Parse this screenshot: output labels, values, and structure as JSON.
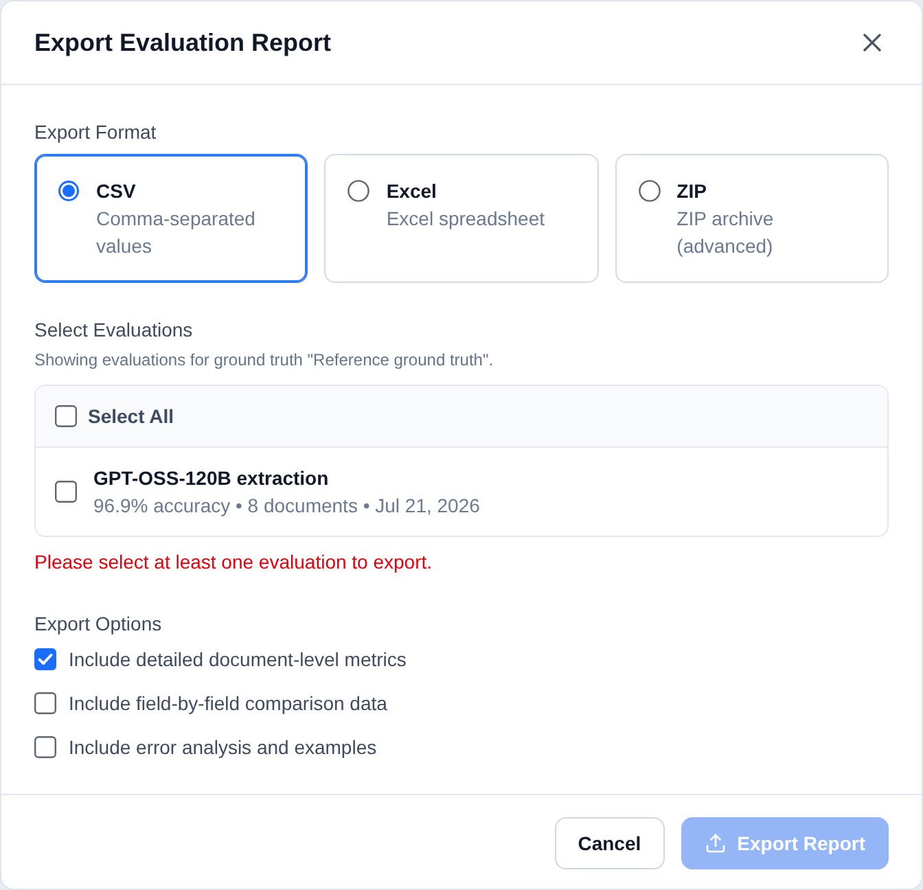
{
  "dialog": {
    "title": "Export Evaluation Report"
  },
  "export_format": {
    "label": "Export Format",
    "options": [
      {
        "name": "CSV",
        "description": "Comma-separated values",
        "selected": true
      },
      {
        "name": "Excel",
        "description": "Excel spreadsheet",
        "selected": false
      },
      {
        "name": "ZIP",
        "description": "ZIP archive (advanced)",
        "selected": false
      }
    ]
  },
  "select_evaluations": {
    "label": "Select Evaluations",
    "hint": "Showing evaluations for ground truth \"Reference ground truth\".",
    "select_all": {
      "label": "Select All",
      "checked": false
    },
    "evaluations": [
      {
        "name": "GPT-OSS-120B extraction",
        "details": "96.9% accuracy • 8 documents • Jul 21, 2026",
        "checked": false
      }
    ],
    "error": "Please select at least one evaluation to export."
  },
  "export_options": {
    "label": "Export Options",
    "options": [
      {
        "label": "Include detailed document-level metrics",
        "checked": true
      },
      {
        "label": "Include field-by-field comparison data",
        "checked": false
      },
      {
        "label": "Include error analysis and examples",
        "checked": false
      }
    ]
  },
  "buttons": [
    {
      "label": "Cancel",
      "kind": "secondary",
      "disabled": false
    },
    {
      "label": "Export Report",
      "kind": "primary",
      "disabled": true
    }
  ]
}
